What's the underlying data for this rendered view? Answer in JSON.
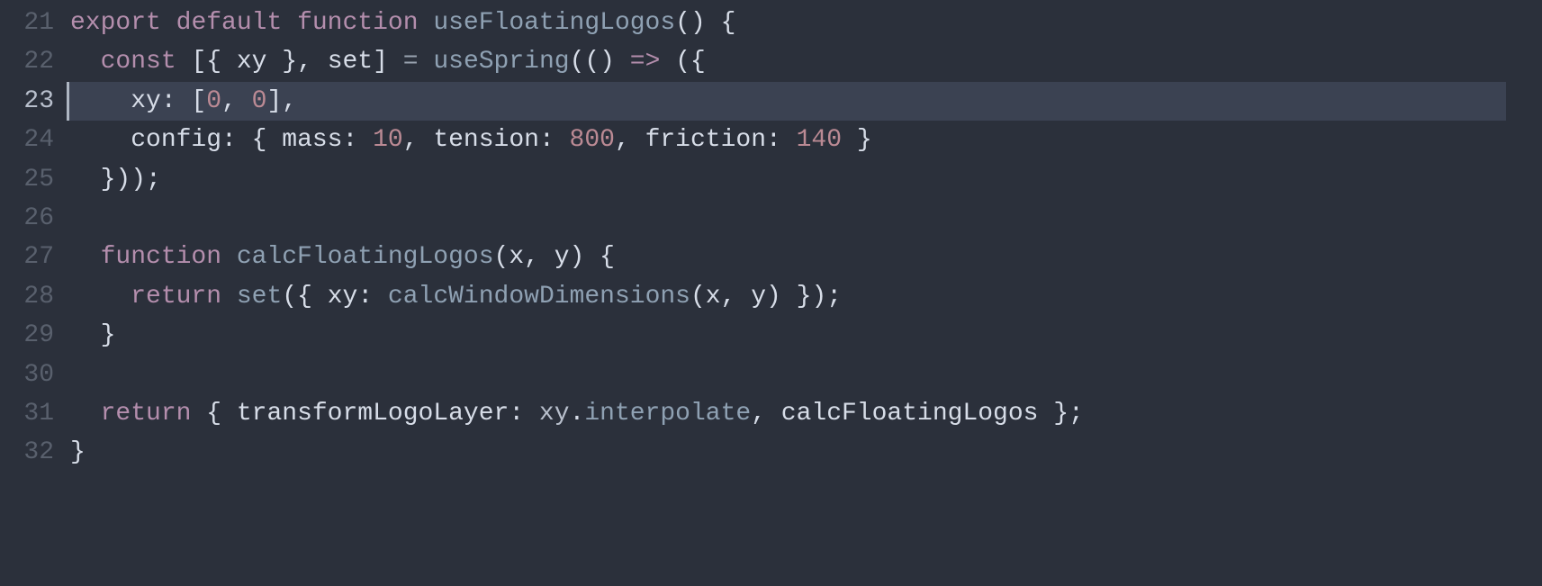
{
  "editor": {
    "startLine": 21,
    "currentLine": 23,
    "lines": [
      {
        "n": 21,
        "tokens": [
          {
            "t": "export",
            "c": "kw"
          },
          {
            "t": " ",
            "c": "pn"
          },
          {
            "t": "default",
            "c": "kw"
          },
          {
            "t": " ",
            "c": "pn"
          },
          {
            "t": "function",
            "c": "kw"
          },
          {
            "t": " ",
            "c": "pn"
          },
          {
            "t": "useFloatingLogos",
            "c": "fn"
          },
          {
            "t": "()",
            "c": "id"
          },
          {
            "t": " ",
            "c": "pn"
          },
          {
            "t": "{",
            "c": "id"
          }
        ]
      },
      {
        "n": 22,
        "tokens": [
          {
            "t": "  ",
            "c": "pn"
          },
          {
            "t": "const",
            "c": "kw"
          },
          {
            "t": " ",
            "c": "pn"
          },
          {
            "t": "[{ ",
            "c": "id"
          },
          {
            "t": "xy",
            "c": "prop"
          },
          {
            "t": " }, ",
            "c": "id"
          },
          {
            "t": "set",
            "c": "prop"
          },
          {
            "t": "] ",
            "c": "id"
          },
          {
            "t": "=",
            "c": "op"
          },
          {
            "t": " ",
            "c": "pn"
          },
          {
            "t": "useSpring",
            "c": "call"
          },
          {
            "t": "(() ",
            "c": "id"
          },
          {
            "t": "=>",
            "c": "kw"
          },
          {
            "t": " ({",
            "c": "id"
          }
        ]
      },
      {
        "n": 23,
        "tokens": [
          {
            "t": "    ",
            "c": "pn"
          },
          {
            "t": "xy",
            "c": "prop"
          },
          {
            "t": ": [",
            "c": "id"
          },
          {
            "t": "0",
            "c": "num"
          },
          {
            "t": ", ",
            "c": "id"
          },
          {
            "t": "0",
            "c": "num"
          },
          {
            "t": "],",
            "c": "id"
          }
        ]
      },
      {
        "n": 24,
        "tokens": [
          {
            "t": "    ",
            "c": "pn"
          },
          {
            "t": "config",
            "c": "prop"
          },
          {
            "t": ": { ",
            "c": "id"
          },
          {
            "t": "mass",
            "c": "prop"
          },
          {
            "t": ": ",
            "c": "id"
          },
          {
            "t": "10",
            "c": "num"
          },
          {
            "t": ", ",
            "c": "id"
          },
          {
            "t": "tension",
            "c": "prop"
          },
          {
            "t": ": ",
            "c": "id"
          },
          {
            "t": "800",
            "c": "num"
          },
          {
            "t": ", ",
            "c": "id"
          },
          {
            "t": "friction",
            "c": "prop"
          },
          {
            "t": ": ",
            "c": "id"
          },
          {
            "t": "140",
            "c": "num"
          },
          {
            "t": " }",
            "c": "id"
          }
        ]
      },
      {
        "n": 25,
        "tokens": [
          {
            "t": "  ",
            "c": "pn"
          },
          {
            "t": "}));",
            "c": "id"
          }
        ]
      },
      {
        "n": 26,
        "tokens": [
          {
            "t": "",
            "c": "pn"
          }
        ]
      },
      {
        "n": 27,
        "tokens": [
          {
            "t": "  ",
            "c": "pn"
          },
          {
            "t": "function",
            "c": "kw"
          },
          {
            "t": " ",
            "c": "pn"
          },
          {
            "t": "calcFloatingLogos",
            "c": "fn"
          },
          {
            "t": "(",
            "c": "id"
          },
          {
            "t": "x",
            "c": "prop"
          },
          {
            "t": ", ",
            "c": "id"
          },
          {
            "t": "y",
            "c": "prop"
          },
          {
            "t": ") {",
            "c": "id"
          }
        ]
      },
      {
        "n": 28,
        "tokens": [
          {
            "t": "    ",
            "c": "pn"
          },
          {
            "t": "return",
            "c": "kw"
          },
          {
            "t": " ",
            "c": "pn"
          },
          {
            "t": "set",
            "c": "call"
          },
          {
            "t": "({ ",
            "c": "id"
          },
          {
            "t": "xy",
            "c": "prop"
          },
          {
            "t": ": ",
            "c": "id"
          },
          {
            "t": "calcWindowDimensions",
            "c": "call"
          },
          {
            "t": "(",
            "c": "id"
          },
          {
            "t": "x",
            "c": "prop"
          },
          {
            "t": ", ",
            "c": "id"
          },
          {
            "t": "y",
            "c": "prop"
          },
          {
            "t": ") });",
            "c": "id"
          }
        ]
      },
      {
        "n": 29,
        "tokens": [
          {
            "t": "  ",
            "c": "pn"
          },
          {
            "t": "}",
            "c": "id"
          }
        ]
      },
      {
        "n": 30,
        "tokens": [
          {
            "t": "",
            "c": "pn"
          }
        ]
      },
      {
        "n": 31,
        "tokens": [
          {
            "t": "  ",
            "c": "pn"
          },
          {
            "t": "return",
            "c": "kw"
          },
          {
            "t": " ",
            "c": "pn"
          },
          {
            "t": "{ ",
            "c": "id"
          },
          {
            "t": "transformLogoLayer",
            "c": "prop"
          },
          {
            "t": ": ",
            "c": "id"
          },
          {
            "t": "xy",
            "c": "pale"
          },
          {
            "t": ".",
            "c": "id"
          },
          {
            "t": "interpolate",
            "c": "call"
          },
          {
            "t": ", ",
            "c": "id"
          },
          {
            "t": "calcFloatingLogos",
            "c": "prop"
          },
          {
            "t": " };",
            "c": "id"
          }
        ]
      },
      {
        "n": 32,
        "tokens": [
          {
            "t": "}",
            "c": "id"
          }
        ]
      }
    ]
  }
}
